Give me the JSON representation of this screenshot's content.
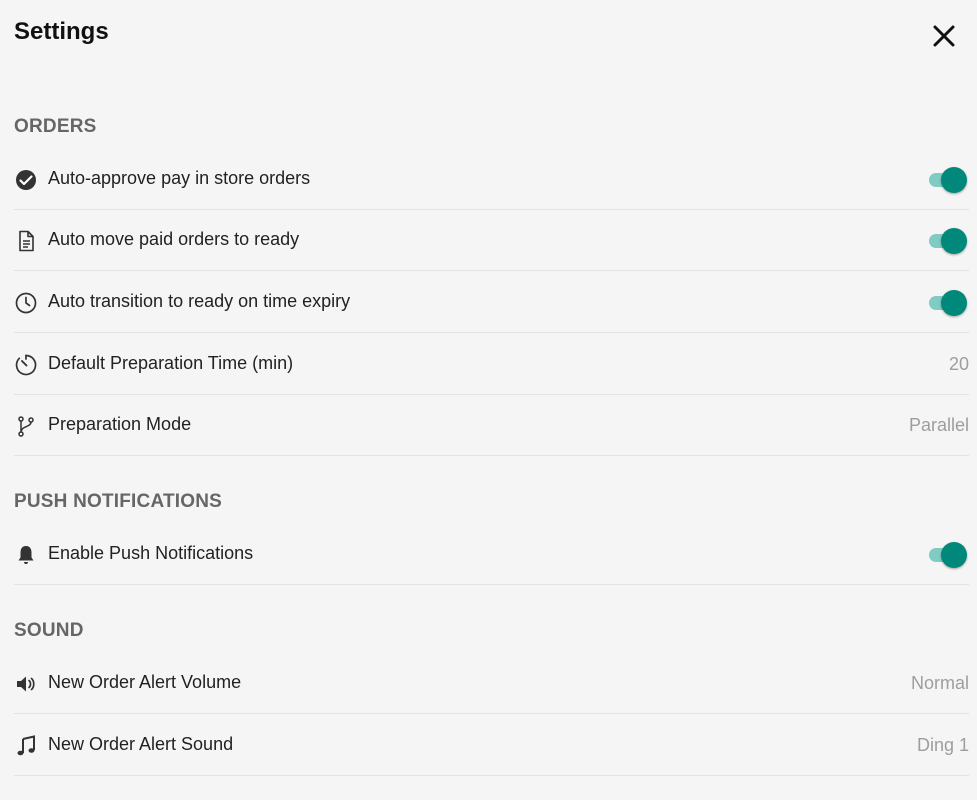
{
  "header": {
    "title": "Settings",
    "close_icon": "close-icon"
  },
  "sections": {
    "orders": {
      "title": "ORDERS",
      "items": [
        {
          "label": "Auto-approve pay in store orders",
          "icon": "check-circle-icon",
          "toggle": true
        },
        {
          "label": "Auto move paid orders to ready",
          "icon": "document-icon",
          "toggle": true
        },
        {
          "label": "Auto transition to ready on time expiry",
          "icon": "clock-icon",
          "toggle": true
        },
        {
          "label": "Default Preparation Time (min)",
          "icon": "timer-icon",
          "value": "20"
        },
        {
          "label": "Preparation Mode",
          "icon": "branch-icon",
          "value": "Parallel"
        }
      ]
    },
    "push": {
      "title": "PUSH NOTIFICATIONS",
      "items": [
        {
          "label": "Enable Push Notifications",
          "icon": "bell-icon",
          "toggle": true
        }
      ]
    },
    "sound": {
      "title": "SOUND",
      "items": [
        {
          "label": "New Order Alert Volume",
          "icon": "speaker-icon",
          "value": "Normal"
        },
        {
          "label": "New Order Alert Sound",
          "icon": "music-note-icon",
          "value": "Ding 1"
        }
      ]
    }
  },
  "colors": {
    "toggle_on": "#00897b",
    "toggle_track": "#80cbc4",
    "section_title": "#666666",
    "value_text": "#9e9e9e"
  }
}
